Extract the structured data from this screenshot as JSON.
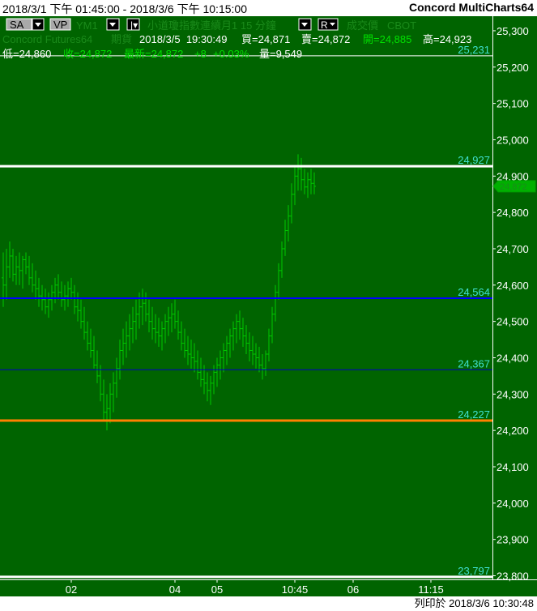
{
  "header": {
    "date_range": "2018/3/1 下午 01:45:00 - 2018/3/6 下午 10:15:00",
    "app_name": "Concord MultiCharts64"
  },
  "toolbar": {
    "sa_label": "SA",
    "vp_label": "VP",
    "symbol": "YM1",
    "symbol_desc": "小道瓊指數連續月1  15 分鐘",
    "type_label": "成交價",
    "exchange": "CBOT",
    "r_label": "R"
  },
  "quote": {
    "source": "Concord Futures64",
    "period": "期貨",
    "datetime": "2018/3/5  19:30:49",
    "bid": "買=24,871",
    "ask": "賣=24,872",
    "open": "開=24,885",
    "high": "高=24,923",
    "low": "低=24,860",
    "close": "收=24,872",
    "last": "最新=24,872",
    "change": "+8",
    "change_pct": "+0.03%",
    "volume": "量=9,549"
  },
  "footer": {
    "print_label": "列印於 2018/3/6 10:30:48"
  },
  "colors": {
    "background": "#006400",
    "bars": "#00c800",
    "axis_text": "#ffffff",
    "line_label": "#40e0d0"
  },
  "chart_data": {
    "type": "bar",
    "ylim": [
      23790,
      25340
    ],
    "y_ticks": [
      25300,
      25200,
      25100,
      25000,
      24900,
      24800,
      24700,
      24600,
      24500,
      24400,
      24300,
      24200,
      24100,
      24000,
      23900,
      23800
    ],
    "y_tick_labels": [
      "25,300",
      "25,200",
      "25,100",
      "25,000",
      "24,900",
      "24,800",
      "24,700",
      "24,600",
      "24,500",
      "24,400",
      "24,300",
      "24,200",
      "24,100",
      "24,000",
      "23,900",
      "23,800"
    ],
    "x_ticks": [
      {
        "label": "02",
        "bar": 21
      },
      {
        "label": "04",
        "bar": 53
      },
      {
        "label": "05",
        "bar": 66
      },
      {
        "label": "10:45",
        "bar": 90
      },
      {
        "label": "06",
        "bar": 108
      },
      {
        "label": "11:15",
        "bar": 132
      }
    ],
    "bar_count": 151,
    "last_price": "24,872",
    "last_price_value": 24872,
    "hlines": [
      {
        "value": 25231,
        "label": "25,231",
        "color": "#ffffff",
        "width": 1
      },
      {
        "value": 24927,
        "label": "24,927",
        "color": "#ffffff",
        "width": 3
      },
      {
        "value": 24564,
        "label": "24,564",
        "color": "#0000ff",
        "width": 2
      },
      {
        "value": 24367,
        "label": "24,367",
        "color": "#0000c0",
        "width": 1
      },
      {
        "value": 24227,
        "label": "24,227",
        "color": "#ff8000",
        "width": 3
      },
      {
        "value": 23797,
        "label": "23,797",
        "color": "#ffffff",
        "width": 3
      }
    ],
    "ohlc": [
      [
        24620,
        24690,
        24540,
        24600
      ],
      [
        24600,
        24700,
        24560,
        24650
      ],
      [
        24650,
        24720,
        24620,
        24680
      ],
      [
        24680,
        24700,
        24610,
        24630
      ],
      [
        24630,
        24680,
        24600,
        24650
      ],
      [
        24650,
        24690,
        24600,
        24640
      ],
      [
        24640,
        24680,
        24590,
        24670
      ],
      [
        24670,
        24690,
        24630,
        24650
      ],
      [
        24650,
        24680,
        24600,
        24620
      ],
      [
        24620,
        24660,
        24580,
        24600
      ],
      [
        24600,
        24640,
        24560,
        24590
      ],
      [
        24590,
        24620,
        24540,
        24570
      ],
      [
        24570,
        24600,
        24530,
        24560
      ],
      [
        24560,
        24590,
        24520,
        24540
      ],
      [
        24540,
        24580,
        24510,
        24560
      ],
      [
        24560,
        24600,
        24530,
        24580
      ],
      [
        24580,
        24620,
        24550,
        24600
      ],
      [
        24600,
        24630,
        24560,
        24580
      ],
      [
        24580,
        24610,
        24540,
        24560
      ],
      [
        24560,
        24600,
        24530,
        24570
      ],
      [
        24570,
        24610,
        24540,
        24590
      ],
      [
        24590,
        24620,
        24560,
        24580
      ],
      [
        24580,
        24600,
        24520,
        24540
      ],
      [
        24540,
        24580,
        24500,
        24530
      ],
      [
        24530,
        24560,
        24480,
        24500
      ],
      [
        24500,
        24540,
        24450,
        24470
      ],
      [
        24470,
        24500,
        24420,
        24440
      ],
      [
        24440,
        24480,
        24400,
        24420
      ],
      [
        24420,
        24460,
        24370,
        24380
      ],
      [
        24380,
        24420,
        24330,
        24350
      ],
      [
        24350,
        24380,
        24280,
        24300
      ],
      [
        24300,
        24340,
        24230,
        24250
      ],
      [
        24250,
        24300,
        24200,
        24260
      ],
      [
        24260,
        24330,
        24220,
        24300
      ],
      [
        24300,
        24360,
        24250,
        24330
      ],
      [
        24330,
        24400,
        24290,
        24370
      ],
      [
        24370,
        24450,
        24340,
        24420
      ],
      [
        24420,
        24480,
        24380,
        24440
      ],
      [
        24440,
        24500,
        24400,
        24460
      ],
      [
        24460,
        24520,
        24420,
        24480
      ],
      [
        24480,
        24540,
        24440,
        24500
      ],
      [
        24500,
        24560,
        24450,
        24520
      ],
      [
        24520,
        24580,
        24480,
        24540
      ],
      [
        24540,
        24590,
        24490,
        24550
      ],
      [
        24550,
        24580,
        24500,
        24520
      ],
      [
        24520,
        24560,
        24470,
        24500
      ],
      [
        24500,
        24540,
        24450,
        24480
      ],
      [
        24480,
        24520,
        24440,
        24470
      ],
      [
        24470,
        24510,
        24430,
        24460
      ],
      [
        24460,
        24500,
        24420,
        24480
      ],
      [
        24480,
        24520,
        24440,
        24500
      ],
      [
        24500,
        24540,
        24460,
        24510
      ],
      [
        24510,
        24550,
        24470,
        24520
      ],
      [
        24520,
        24560,
        24480,
        24500
      ],
      [
        24500,
        24530,
        24450,
        24470
      ],
      [
        24470,
        24500,
        24420,
        24440
      ],
      [
        24440,
        24480,
        24400,
        24420
      ],
      [
        24420,
        24460,
        24380,
        24410
      ],
      [
        24410,
        24450,
        24370,
        24400
      ],
      [
        24400,
        24440,
        24360,
        24390
      ],
      [
        24390,
        24420,
        24340,
        24360
      ],
      [
        24360,
        24400,
        24320,
        24340
      ],
      [
        24340,
        24380,
        24300,
        24330
      ],
      [
        24330,
        24360,
        24280,
        24310
      ],
      [
        24310,
        24350,
        24270,
        24330
      ],
      [
        24330,
        24380,
        24300,
        24360
      ],
      [
        24360,
        24400,
        24320,
        24380
      ],
      [
        24380,
        24420,
        24340,
        24400
      ],
      [
        24400,
        24440,
        24360,
        24420
      ],
      [
        24420,
        24460,
        24380,
        24440
      ],
      [
        24440,
        24480,
        24400,
        24460
      ],
      [
        24460,
        24500,
        24420,
        24480
      ],
      [
        24480,
        24520,
        24440,
        24500
      ],
      [
        24500,
        24530,
        24450,
        24480
      ],
      [
        24480,
        24510,
        24430,
        24460
      ],
      [
        24460,
        24490,
        24410,
        24440
      ],
      [
        24440,
        24470,
        24390,
        24420
      ],
      [
        24420,
        24460,
        24380,
        24410
      ],
      [
        24410,
        24440,
        24370,
        24400
      ],
      [
        24400,
        24430,
        24360,
        24380
      ],
      [
        24380,
        24410,
        24340,
        24370
      ],
      [
        24370,
        24420,
        24350,
        24410
      ],
      [
        24410,
        24480,
        24390,
        24460
      ],
      [
        24460,
        24540,
        24440,
        24520
      ],
      [
        24520,
        24600,
        24500,
        24580
      ],
      [
        24580,
        24660,
        24560,
        24640
      ],
      [
        24640,
        24720,
        24620,
        24700
      ],
      [
        24700,
        24780,
        24680,
        24750
      ],
      [
        24750,
        24820,
        24720,
        24790
      ],
      [
        24790,
        24880,
        24770,
        24850
      ],
      [
        24850,
        24930,
        24820,
        24900
      ],
      [
        24900,
        24960,
        24860,
        24920
      ],
      [
        24920,
        24950,
        24860,
        24890
      ],
      [
        24890,
        24920,
        24850,
        24870
      ],
      [
        24870,
        24910,
        24840,
        24890
      ],
      [
        24890,
        24920,
        24850,
        24880
      ],
      [
        24880,
        24910,
        24850,
        24872
      ]
    ]
  }
}
